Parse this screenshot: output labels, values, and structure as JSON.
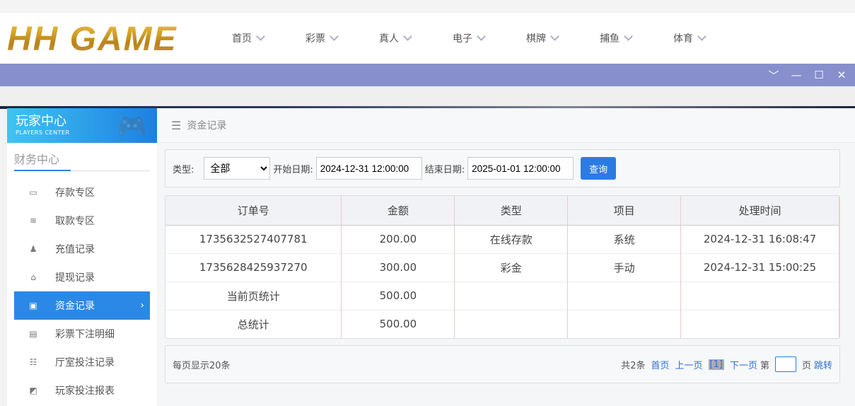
{
  "header": {
    "logo": "HH GAME",
    "nav": [
      "首页",
      "彩票",
      "真人",
      "电子",
      "棋牌",
      "捕鱼",
      "体育"
    ]
  },
  "window_controls": {
    "collapse": "﹀",
    "minimize": "—",
    "maximize": "☐",
    "close": "✕"
  },
  "sidebar": {
    "title": "玩家中心",
    "subtitle": "PLAYERS CENTER",
    "section": "财务中心",
    "items": [
      {
        "label": "存款专区",
        "icon": "card-icon",
        "glyph": "▭"
      },
      {
        "label": "取款专区",
        "icon": "hand-money-icon",
        "glyph": "≋"
      },
      {
        "label": "充值记录",
        "icon": "money-bag-icon",
        "glyph": "♟"
      },
      {
        "label": "提现记录",
        "icon": "wallet-icon",
        "glyph": "⌂"
      },
      {
        "label": "资金记录",
        "icon": "funds-icon",
        "glyph": "▣",
        "active": true
      },
      {
        "label": "彩票下注明细",
        "icon": "list-icon",
        "glyph": "▤"
      },
      {
        "label": "厅室投注记录",
        "icon": "bullet-list-icon",
        "glyph": "☷"
      },
      {
        "label": "玩家投注报表",
        "icon": "chart-icon",
        "glyph": "◩"
      }
    ]
  },
  "breadcrumb": "资金记录",
  "filter": {
    "type_label": "类型:",
    "type_value": "全部",
    "start_label": "开始日期:",
    "start_value": "2024-12-31 12:00:00",
    "end_label": "结束日期:",
    "end_value": "2025-01-01 12:00:00",
    "query_button": "查询"
  },
  "table": {
    "headers": [
      "订单号",
      "金额",
      "类型",
      "项目",
      "处理时间"
    ],
    "rows": [
      [
        "1735632527407781",
        "200.00",
        "在线存款",
        "系统",
        "2024-12-31 16:08:47"
      ],
      [
        "1735628425937270",
        "300.00",
        "彩金",
        "手动",
        "2024-12-31 15:00:25"
      ],
      [
        "当前页统计",
        "500.00",
        "",
        "",
        ""
      ],
      [
        "总统计",
        "500.00",
        "",
        "",
        ""
      ]
    ]
  },
  "pager": {
    "per_page": "每页显示20条",
    "total": "共2条",
    "first": "首页",
    "prev": "上一页",
    "current": "[1]",
    "next": "下一页",
    "goto_prefix": "第",
    "goto_suffix": "页",
    "jump": "跳转"
  },
  "colors": {
    "accent": "#2b88e6",
    "window_bar": "#8790cc"
  }
}
